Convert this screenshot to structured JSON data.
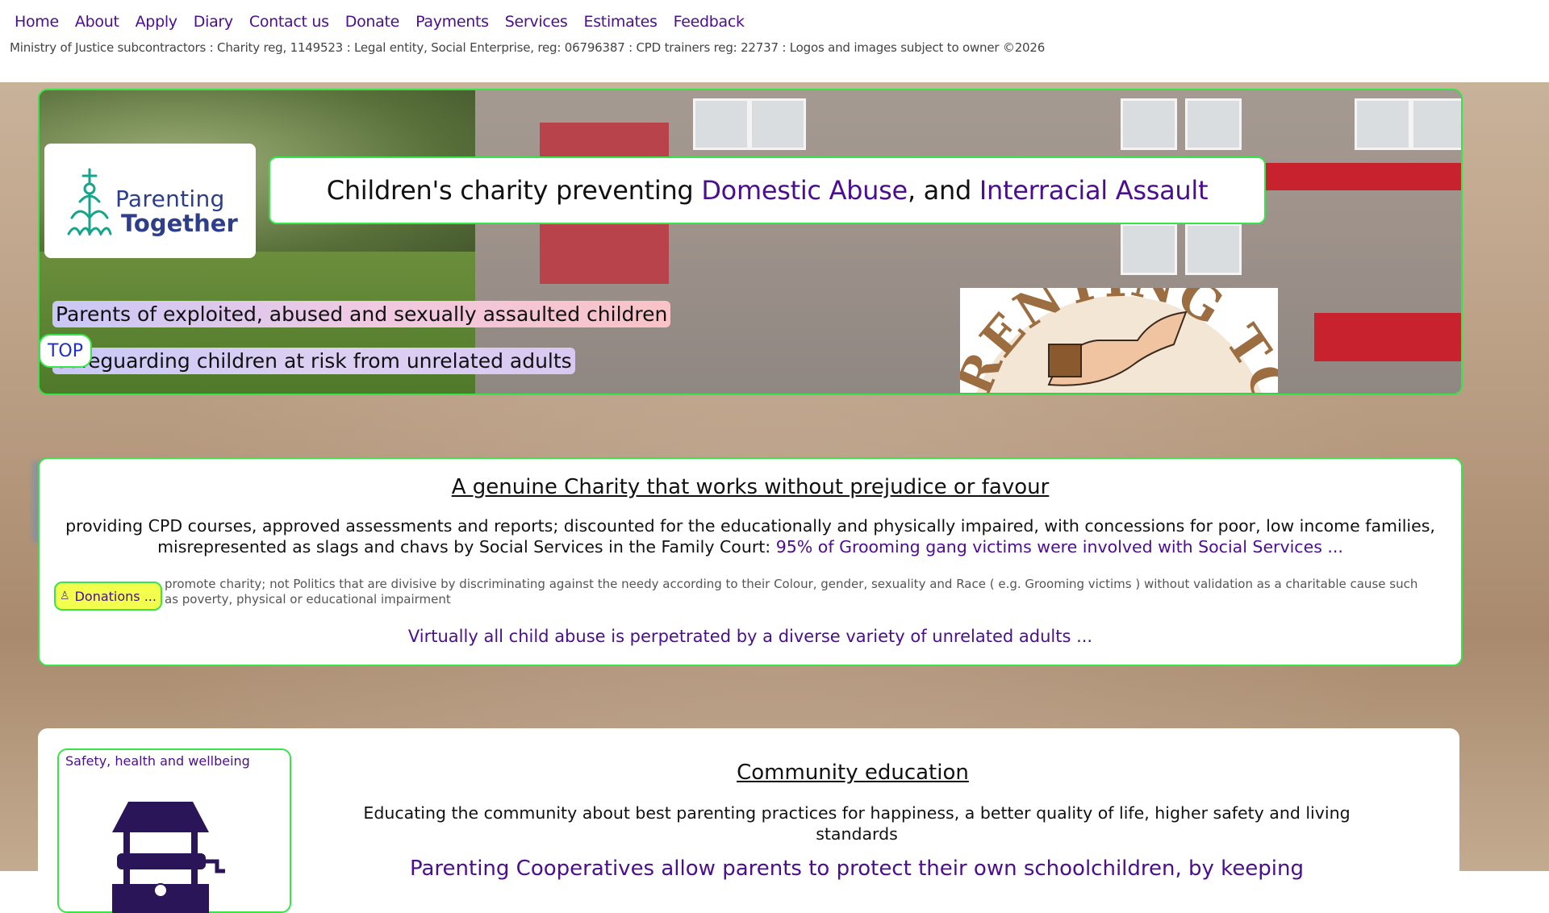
{
  "nav": {
    "links": [
      "Home",
      "About",
      "Apply",
      "Diary",
      "Contact us",
      "Donate",
      "Payments",
      "Services",
      "Estimates",
      "Feedback"
    ],
    "reg_line": "Ministry of Justice subcontractors : Charity reg, 1149523 : Legal entity, Social Enterprise, reg: 06796387 : CPD trainers reg: 22737 : Logos and images subject to owner ©2026"
  },
  "banner": {
    "logo": {
      "line1": "Parenting",
      "line2": "Together"
    },
    "headline": {
      "prefix": "Children's charity preventing ",
      "hl1": "Domestic Abuse",
      "mid": ", and ",
      "hl2": "Interracial Assault"
    },
    "pill1": "Parents of exploited, abused and sexually assaulted children",
    "pill2": "Safeguarding children at risk from unrelated adults",
    "top_button": "TOP",
    "seal_text": "RENTING TOGETHE"
  },
  "charity": {
    "title": "A genuine Charity that works without prejudice or favour",
    "para": "providing CPD courses, approved assessments and reports;  discounted for the educationally and physically impaired, with concessions for poor, low income families, misrepresented as slags and chavs by Social Services in the Family Court: ",
    "para_link": "95% of Grooming gang victims were involved with Social Services ...",
    "donate_button": "Donations ...",
    "small_para": "promote charity;  not Politics that are divisive by discriminating against the needy according to their Colour, gender, sexuality and Race ( e.g. Grooming victims ) without validation as a charitable cause such as poverty, physical or educational impairment",
    "virtually": "Virtually all child abuse is perpetrated by a diverse variety of unrelated adults ..."
  },
  "community": {
    "side_title": "Safety, health and wellbeing",
    "title": "Community education",
    "para": "Educating the community about best parenting practices for happiness, a better quality of life, higher safety and living standards",
    "para2": "Parenting Cooperatives allow parents to protect their own schoolchildren, by keeping"
  },
  "colors": {
    "accent": "#4b0e8f",
    "border_green": "#39e34a",
    "donate_yellow": "#f2ff4c"
  }
}
